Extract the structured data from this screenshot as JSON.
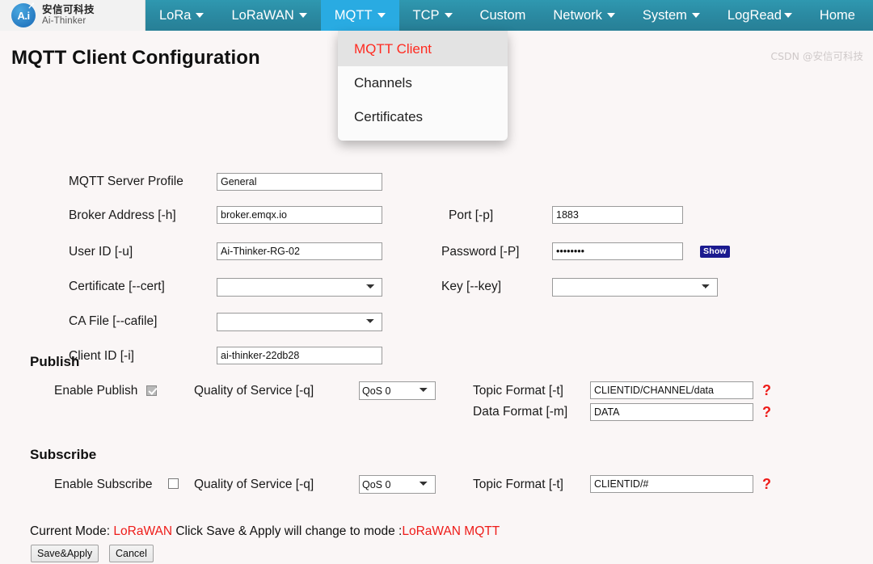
{
  "brand": {
    "cn_name": "安信可科技",
    "en_name": "Ai-Thinker",
    "logo_text": "A.i"
  },
  "nav": {
    "items": [
      {
        "label": "LoRa",
        "caret": true,
        "active": false
      },
      {
        "label": "LoRaWAN",
        "caret": true,
        "active": false
      },
      {
        "label": "MQTT",
        "caret": true,
        "active": true
      },
      {
        "label": "TCP",
        "caret": true,
        "active": false
      },
      {
        "label": "Custom",
        "caret": false,
        "active": false
      },
      {
        "label": "Network",
        "caret": true,
        "active": false
      },
      {
        "label": "System",
        "caret": true,
        "active": false
      },
      {
        "label": "LogRead",
        "caret": true,
        "active": false
      },
      {
        "label": "Home",
        "caret": false,
        "active": false
      }
    ]
  },
  "dropdown": {
    "items": [
      {
        "label": "MQTT Client",
        "selected": true
      },
      {
        "label": "Channels",
        "selected": false
      },
      {
        "label": "Certificates",
        "selected": false
      }
    ]
  },
  "page": {
    "title": "MQTT Client Configuration"
  },
  "form": {
    "server_profile_label": "MQTT Server Profile",
    "server_profile_value": "General",
    "broker_address_label": "Broker Address [-h]",
    "broker_address_value": "broker.emqx.io",
    "port_label": "Port [-p]",
    "port_value": "1883",
    "user_id_label": "User ID [-u]",
    "user_id_value": "Ai-Thinker-RG-02",
    "password_label": "Password [-P]",
    "password_value": "••••••••",
    "password_show_label": "Show",
    "certificate_label": "Certificate [--cert]",
    "certificate_value": "",
    "key_label": "Key [--key]",
    "key_value": "",
    "cafile_label": "CA File [--cafile]",
    "cafile_value": "",
    "client_id_label": "Client ID [-i]",
    "client_id_value": "ai-thinker-22db28"
  },
  "publish": {
    "section_title": "Publish",
    "enable_label": "Enable Publish",
    "enable_checked": true,
    "qos_label": "Quality of Service [-q]",
    "qos_value": "QoS 0",
    "topic_label": "Topic Format [-t]",
    "topic_value": "CLIENTID/CHANNEL/data",
    "data_label": "Data Format [-m]",
    "data_value": "DATA",
    "help_glyph": "?"
  },
  "subscribe": {
    "section_title": "Subscribe",
    "enable_label": "Enable Subscribe",
    "enable_checked": false,
    "qos_label": "Quality of Service [-q]",
    "qos_value": "QoS 0",
    "topic_label": "Topic Format [-t]",
    "topic_value": "CLIENTID/#",
    "help_glyph": "?"
  },
  "footer": {
    "mode_prefix": "Current Mode: ",
    "current_mode": "LoRaWAN",
    "mode_middle": " Click Save & Apply will change to mode :",
    "target_mode": "LoRaWAN MQTT",
    "save_label": "Save&Apply",
    "cancel_label": "Cancel"
  },
  "watermark": "CSDN @安信可科技",
  "colors": {
    "nav_bg": "#2b8ba3",
    "nav_active": "#29abe2",
    "accent_red": "#ee1b18",
    "badge_blue": "#1b1b8f",
    "page_bg": "#faf6f6"
  }
}
